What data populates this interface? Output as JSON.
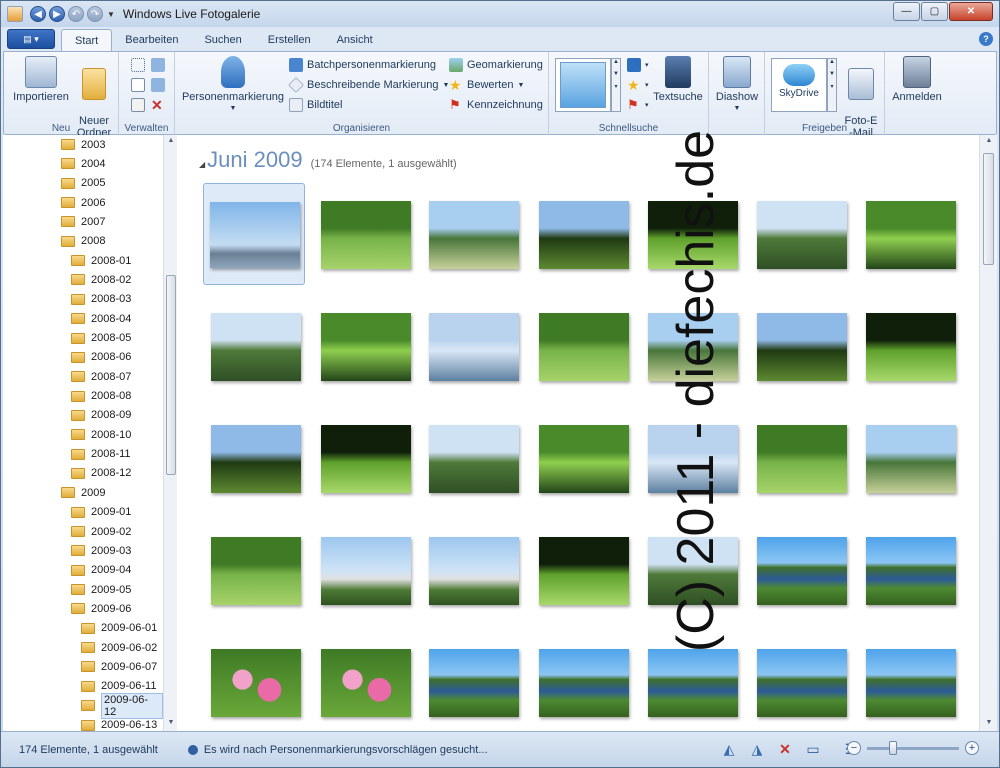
{
  "window": {
    "title": "Windows Live Fotogalerie"
  },
  "tabs": [
    "Start",
    "Bearbeiten",
    "Suchen",
    "Erstellen",
    "Ansicht"
  ],
  "ribbon": {
    "groups": {
      "neu": "Neu",
      "verwalten": "Verwalten",
      "organisieren": "Organisieren",
      "schnellsuche": "Schnellsuche",
      "freigeben": "Freigeben"
    },
    "importieren": "Importieren",
    "neuer_ordner": "Neuer\nOrdner",
    "personenmarkierung": "Personenmarkierung",
    "batch": "Batchpersonenmarkierung",
    "beschreibend": "Beschreibende Markierung",
    "bildtitel": "Bildtitel",
    "geomarkierung": "Geomarkierung",
    "bewerten": "Bewerten",
    "kennzeichnung": "Kennzeichnung",
    "textsuche": "Textsuche",
    "diashow": "Diashow",
    "skydrive": "SkyDrive",
    "foto_email": "Foto-E\n-Mail",
    "anmelden": "Anmelden"
  },
  "tree": {
    "items": [
      {
        "label": "2003",
        "level": 0
      },
      {
        "label": "2004",
        "level": 0
      },
      {
        "label": "2005",
        "level": 0
      },
      {
        "label": "2006",
        "level": 0
      },
      {
        "label": "2007",
        "level": 0
      },
      {
        "label": "2008",
        "level": 0
      },
      {
        "label": "2008-01",
        "level": 1
      },
      {
        "label": "2008-02",
        "level": 1
      },
      {
        "label": "2008-03",
        "level": 1
      },
      {
        "label": "2008-04",
        "level": 1
      },
      {
        "label": "2008-05",
        "level": 1
      },
      {
        "label": "2008-06",
        "level": 1
      },
      {
        "label": "2008-07",
        "level": 1
      },
      {
        "label": "2008-08",
        "level": 1
      },
      {
        "label": "2008-09",
        "level": 1
      },
      {
        "label": "2008-10",
        "level": 1
      },
      {
        "label": "2008-11",
        "level": 1
      },
      {
        "label": "2008-12",
        "level": 1
      },
      {
        "label": "2009",
        "level": 0
      },
      {
        "label": "2009-01",
        "level": 1
      },
      {
        "label": "2009-02",
        "level": 1
      },
      {
        "label": "2009-03",
        "level": 1
      },
      {
        "label": "2009-04",
        "level": 1
      },
      {
        "label": "2009-05",
        "level": 1
      },
      {
        "label": "2009-06",
        "level": 1
      },
      {
        "label": "2009-06-01",
        "level": 2
      },
      {
        "label": "2009-06-02",
        "level": 2
      },
      {
        "label": "2009-06-07",
        "level": 2
      },
      {
        "label": "2009-06-11",
        "level": 2
      },
      {
        "label": "2009-06-12",
        "level": 2,
        "selected": true
      },
      {
        "label": "2009-06-13",
        "level": 2
      }
    ]
  },
  "gallery": {
    "group_title": "Juni 2009",
    "group_subtitle": "(174 Elemente, 1 ausgewählt)",
    "photos": [
      "sky-panorama",
      "valley-lake",
      "tree-silhouette",
      "green-meadow",
      "meadow-sunlit",
      "meadow-white-bird",
      "hills-lake",
      "trees-red-roof",
      "trees-red-roof-2",
      "vineyard-sky",
      "town-hills",
      "meadow-sky",
      "distant-tower",
      "meadow-hill",
      "field-trees",
      "grass-dark",
      "grass-dark-2",
      "plants-sky",
      "grass-trees",
      "tree-field",
      "branch-blue-sky",
      "vineyard-green",
      "city-buildings",
      "city-panorama",
      "vineyard-row",
      "vineyard-row-2",
      "river-valley",
      "river-valley-2",
      "pink-roses",
      "pink-roses-2",
      "river-bend",
      "river-bend-2",
      "river-bend-3",
      "river-bend-4",
      "river-bend-5"
    ]
  },
  "status": {
    "count": "174 Elemente, 1 ausgewählt",
    "message": "Es wird nach Personenmarkierungsvorschlägen gesucht..."
  },
  "watermark": "(C) 2011 - diefechis.de",
  "colors": {
    "accent": "#1c4f9f",
    "selection": "#dfeaf8",
    "title_blue": "#6a8fbf"
  }
}
